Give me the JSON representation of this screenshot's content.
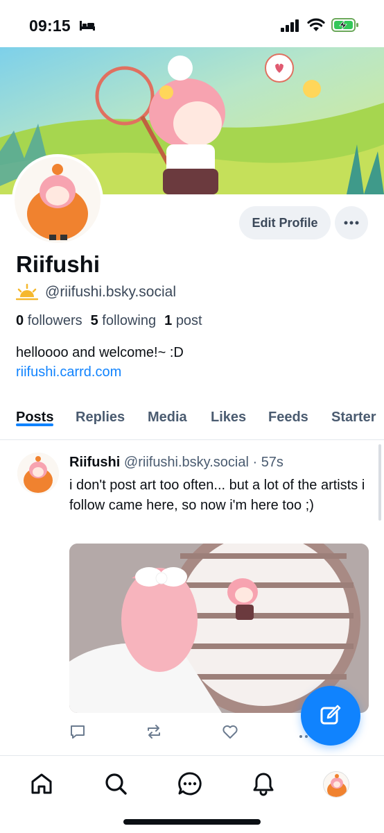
{
  "status_bar": {
    "time": "09:15",
    "icons": [
      "bed-icon",
      "signal-icon",
      "wifi-icon",
      "battery-charging-icon"
    ]
  },
  "profile": {
    "edit_label": "Edit Profile",
    "more_icon": "ellipsis-icon",
    "display_name": "Riifushi",
    "handle_icon": "sun-icon",
    "handle": "@riifushi.bsky.social",
    "stats": {
      "followers_count": "0",
      "followers_label": "followers",
      "following_count": "5",
      "following_label": "following",
      "posts_count": "1",
      "posts_label": "post"
    },
    "bio": "helloooo and welcome!~ :D",
    "link": "riifushi.carrd.com"
  },
  "tabs": [
    {
      "label": "Posts",
      "active": true
    },
    {
      "label": "Replies",
      "active": false
    },
    {
      "label": "Media",
      "active": false
    },
    {
      "label": "Likes",
      "active": false
    },
    {
      "label": "Feeds",
      "active": false
    },
    {
      "label": "Starter",
      "active": false
    }
  ],
  "post": {
    "author": "Riifushi",
    "handle": "@riifushi.bsky.social",
    "separator": "·",
    "time": "57s",
    "text": "i don't post art too often... but a lot of the artists i follow came here, so now i'm here too ;)",
    "actions": [
      "reply-icon",
      "repost-icon",
      "like-icon",
      "more-icon"
    ]
  },
  "compose_icon": "compose-icon",
  "bottom_nav": [
    "home-icon",
    "search-icon",
    "chat-icon",
    "bell-icon",
    "profile-avatar"
  ],
  "colors": {
    "accent": "#1083fe",
    "text_primary": "#0b0f14",
    "text_secondary": "#4a5b70",
    "button_bg": "#eef1f5"
  }
}
